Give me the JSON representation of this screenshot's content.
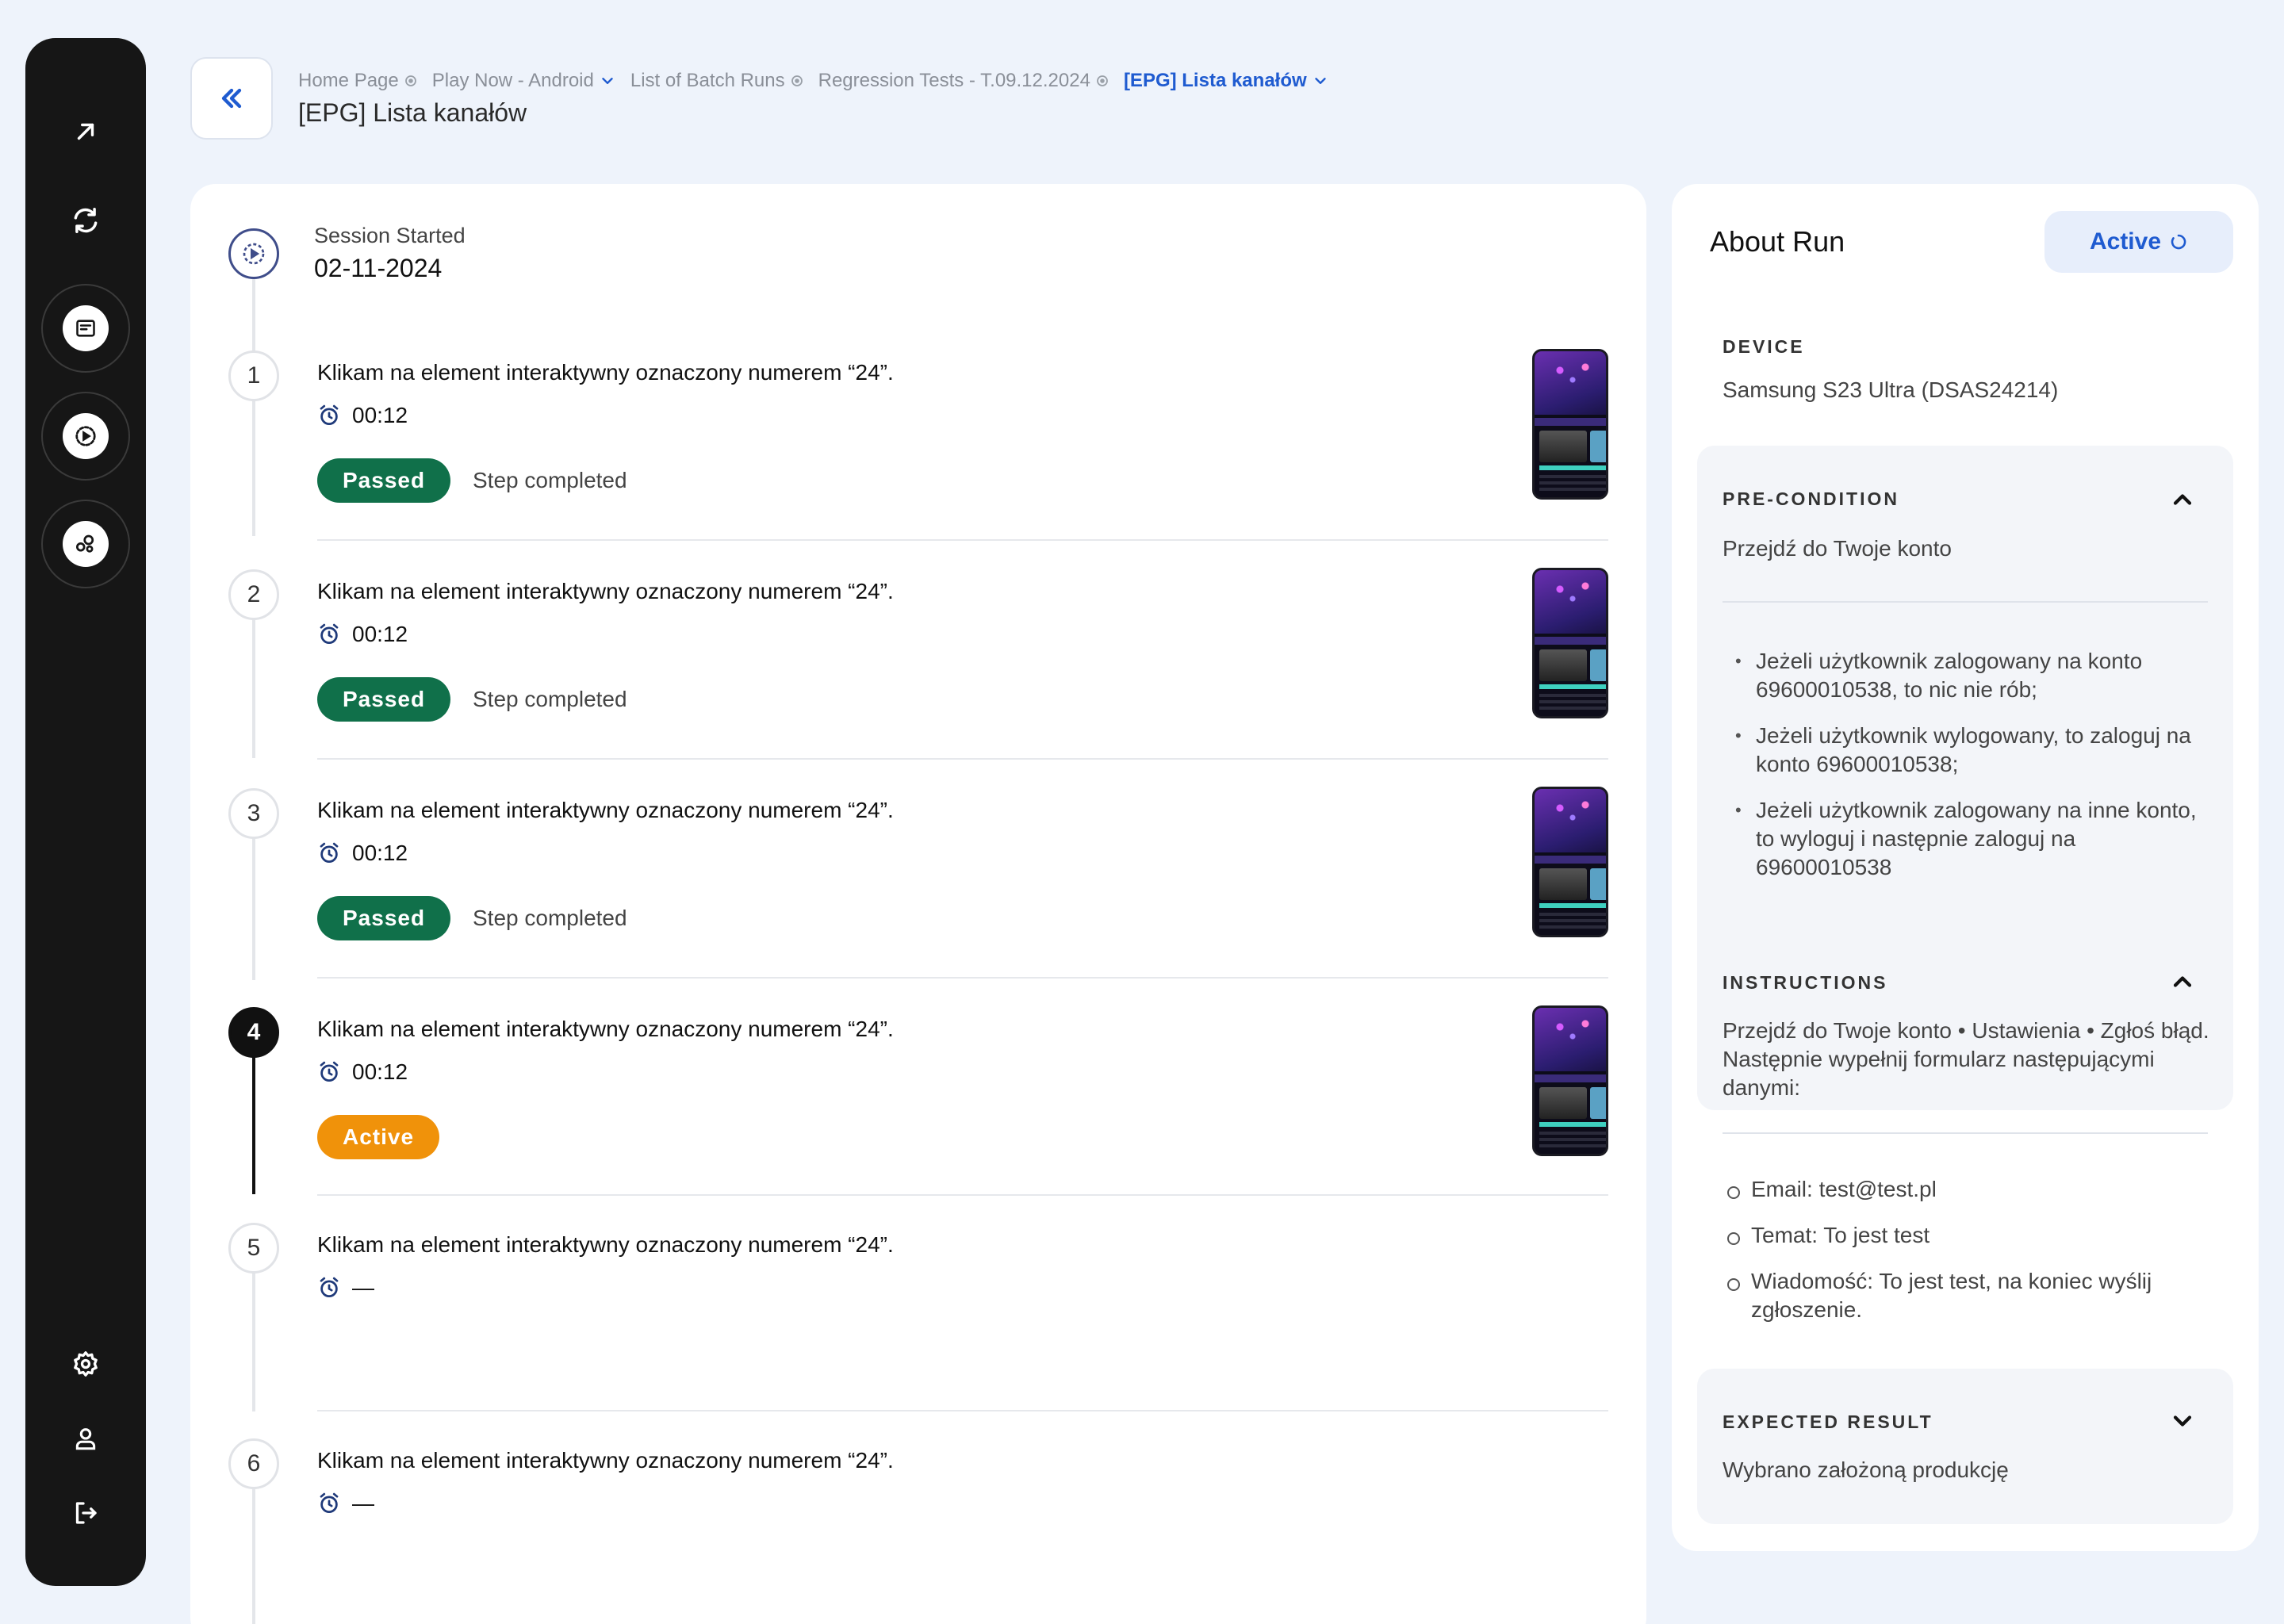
{
  "breadcrumb": [
    {
      "label": "Home Page",
      "sep": "dot"
    },
    {
      "label": "Play Now - Android",
      "sep": "chevron"
    },
    {
      "label": "List of Batch Runs",
      "sep": "dot"
    },
    {
      "label": "Regression Tests - T.09.12.2024",
      "sep": "dot"
    },
    {
      "label": "[EPG] Lista kanałów",
      "sep": "chevron"
    }
  ],
  "page": {
    "title": "[EPG] Lista kanałów"
  },
  "session": {
    "label": "Session Started",
    "date": "02-11-2024"
  },
  "steps": [
    {
      "number": "1",
      "text": "Klikam na element interaktywny oznaczony numerem “24”.",
      "time": "00:12",
      "status": "Passed",
      "note": "Step completed"
    },
    {
      "number": "2",
      "text": "Klikam na element interaktywny oznaczony numerem “24”.",
      "time": "00:12",
      "status": "Passed",
      "note": "Step completed"
    },
    {
      "number": "3",
      "text": "Klikam na element interaktywny oznaczony numerem “24”.",
      "time": "00:12",
      "status": "Passed",
      "note": "Step completed"
    },
    {
      "number": "4",
      "text": "Klikam na element interaktywny oznaczony numerem “24”.",
      "time": "00:12",
      "status": "Active",
      "note": ""
    },
    {
      "number": "5",
      "text": "Klikam na element interaktywny oznaczony numerem “24”.",
      "time": "—",
      "status": "",
      "note": ""
    },
    {
      "number": "6",
      "text": "Klikam na element interaktywny oznaczony numerem “24”.",
      "time": "—",
      "status": "",
      "note": ""
    }
  ],
  "about": {
    "title": "About Run",
    "status": "Active",
    "device_label": "DEVICE",
    "device_value": "Samsung S23 Ultra (DSAS24214)",
    "precondition": {
      "label": "PRE-CONDITION",
      "summary": "Przejdź do Twoje konto",
      "items": [
        "Jeżeli użytkownik zalogowany na konto 69600010538, to nic nie rób;",
        "Jeżeli użytkownik wylogowany, to zaloguj na konto 69600010538;",
        "Jeżeli użytkownik zalogowany na inne konto, to wyloguj i następnie zaloguj na 69600010538"
      ]
    },
    "instructions": {
      "label": "INSTRUCTIONS",
      "text": "Przejdź do Twoje konto • Ustawienia • Zgłoś błąd. Następnie wypełnij formularz następującymi danymi:",
      "items": [
        "Email: test@test.pl",
        "Temat: To jest test",
        "Wiadomość: To jest test, na koniec wyślij zgłoszenie."
      ]
    },
    "expected": {
      "label": "EXPECTED RESULT",
      "text": "Wybrano założoną produkcję"
    }
  },
  "colors": {
    "accent": "#1f5bd0",
    "passed": "#10704a",
    "active": "#f0920a",
    "sidebar": "#161616"
  },
  "icons": {
    "sidebar": [
      "arrow-up-right-icon",
      "sync-icon",
      "document-icon",
      "play-circle-icon",
      "integrations-icon",
      "gear-icon",
      "user-icon",
      "logout-icon"
    ],
    "back": "double-chevron-left-icon",
    "step_time": "alarm-clock-icon"
  }
}
